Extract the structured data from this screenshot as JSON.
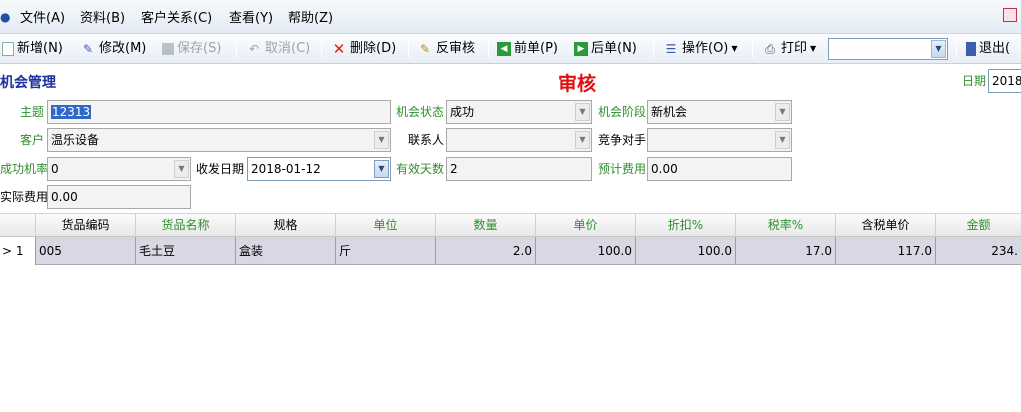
{
  "menubar": {
    "items": [
      "文件(A)",
      "资料(B)",
      "客户关系(C)",
      "查看(Y)",
      "帮助(Z)"
    ]
  },
  "toolbar": {
    "new": "新增(N)",
    "edit": "修改(M)",
    "save": "保存(S)",
    "cancel": "取消(C)",
    "delete": "删除(D)",
    "unaudit": "反审核",
    "prev": "前单(P)",
    "next": "后单(N)",
    "ops": "操作(O)",
    "print": "打印",
    "search_value": "",
    "exit": "退出("
  },
  "form": {
    "title": "机会管理",
    "status": "审核",
    "date_label": "日期",
    "date_value": "2018",
    "subject_label": "主题",
    "subject_value": "12313",
    "opp_status_label": "机会状态",
    "opp_status_value": "成功",
    "opp_stage_label": "机会阶段",
    "opp_stage_value": "新机会",
    "customer_label": "客户",
    "customer_value": "温乐设备",
    "contact_label": "联系人",
    "contact_value": "",
    "competitor_label": "竞争对手",
    "competitor_value": "",
    "success_rate_label": "成功机率",
    "success_rate_value": "0",
    "ship_date_label": "收发日期",
    "ship_date_value": "2018-01-12",
    "valid_days_label": "有效天数",
    "valid_days_value": "2",
    "est_cost_label": "预计费用",
    "est_cost_value": "0.00",
    "actual_cost_label": "实际费用",
    "actual_cost_value": "0.00"
  },
  "grid": {
    "headers": [
      "货品编码",
      "货品名称",
      "规格",
      "单位",
      "数量",
      "单价",
      "折扣%",
      "税率%",
      "含税单价",
      "金额"
    ],
    "rows": [
      {
        "index": "1",
        "code": "005",
        "name": "毛土豆",
        "spec": "盒装",
        "unit": "斤",
        "qty": "2.0",
        "price": "100.0",
        "discount": "100.0",
        "tax": "17.0",
        "taxed_price": "117.0",
        "amount": "234."
      }
    ]
  },
  "colors": {
    "title": "#1b2f9e",
    "status": "#e01010",
    "label_green": "#2f8f2f",
    "selection": "#3168c6"
  }
}
